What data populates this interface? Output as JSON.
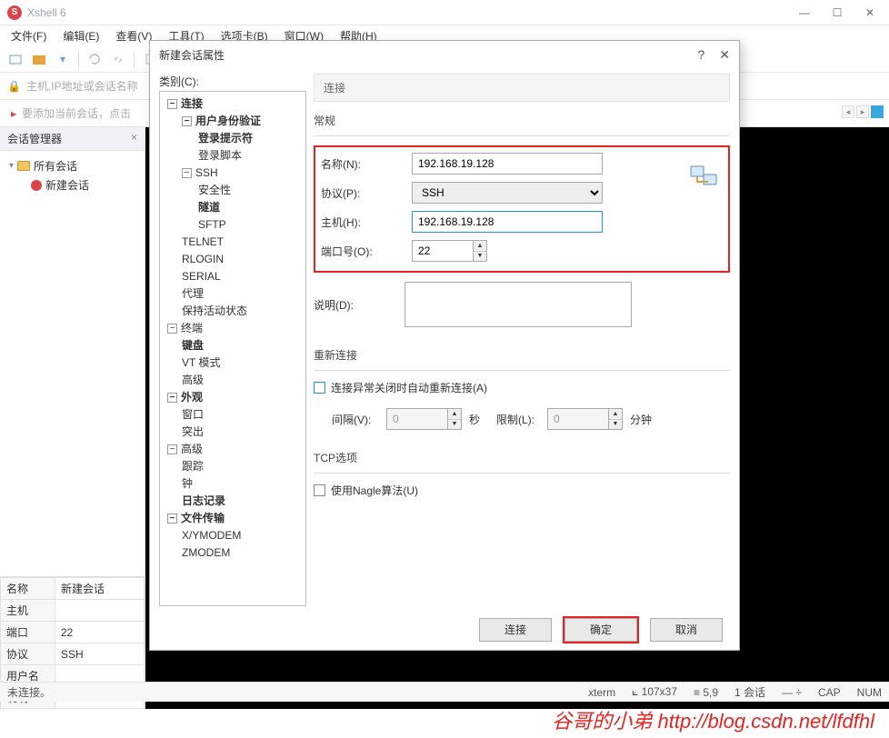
{
  "app": {
    "title": "Xshell 6"
  },
  "menu": [
    "文件(F)",
    "编辑(E)",
    "查看(V)",
    "工具(T)",
    "选项卡(B)",
    "窗口(W)",
    "帮助(H)"
  ],
  "addrbar": {
    "hint": "主机,IP地址或会话名称",
    "flag_hint": "要添加当前会话，点击"
  },
  "session_manager": {
    "title": "会话管理器",
    "root": "所有会话",
    "item": "新建会话"
  },
  "props": {
    "rows": [
      {
        "k": "名称",
        "v": "新建会话"
      },
      {
        "k": "主机",
        "v": ""
      },
      {
        "k": "端口",
        "v": "22"
      },
      {
        "k": "协议",
        "v": "SSH"
      },
      {
        "k": "用户名",
        "v": ""
      },
      {
        "k": "说明",
        "v": ""
      }
    ]
  },
  "dialog": {
    "title": "新建会话属性",
    "category_label": "类别(C):",
    "tree": [
      {
        "l": 0,
        "t": "连接",
        "b": true,
        "e": "−"
      },
      {
        "l": 1,
        "t": "用户身份验证",
        "b": true,
        "e": "−"
      },
      {
        "l": 2,
        "t": "登录提示符",
        "b": true
      },
      {
        "l": 2,
        "t": "登录脚本"
      },
      {
        "l": 1,
        "t": "SSH",
        "e": "−"
      },
      {
        "l": 2,
        "t": "安全性"
      },
      {
        "l": 2,
        "t": "隧道",
        "b": true
      },
      {
        "l": 2,
        "t": "SFTP"
      },
      {
        "l": 1,
        "t": "TELNET"
      },
      {
        "l": 1,
        "t": "RLOGIN"
      },
      {
        "l": 1,
        "t": "SERIAL"
      },
      {
        "l": 1,
        "t": "代理"
      },
      {
        "l": 1,
        "t": "保持活动状态"
      },
      {
        "l": 0,
        "t": "终端",
        "e": "−"
      },
      {
        "l": 1,
        "t": "键盘",
        "b": true
      },
      {
        "l": 1,
        "t": "VT 模式"
      },
      {
        "l": 1,
        "t": "高级"
      },
      {
        "l": 0,
        "t": "外观",
        "b": true,
        "e": "−"
      },
      {
        "l": 1,
        "t": "窗口"
      },
      {
        "l": 1,
        "t": "突出"
      },
      {
        "l": 0,
        "t": "高级",
        "e": "−"
      },
      {
        "l": 1,
        "t": "跟踪"
      },
      {
        "l": 1,
        "t": "钟"
      },
      {
        "l": 1,
        "t": "日志记录",
        "b": true
      },
      {
        "l": 0,
        "t": "文件传输",
        "b": true,
        "e": "−"
      },
      {
        "l": 1,
        "t": "X/YMODEM"
      },
      {
        "l": 1,
        "t": "ZMODEM"
      }
    ],
    "head": "连接",
    "general": {
      "title": "常规",
      "name_l": "名称(N):",
      "name_v": "192.168.19.128",
      "proto_l": "协议(P):",
      "proto_v": "SSH",
      "host_l": "主机(H):",
      "host_v": "192.168.19.128",
      "port_l": "端口号(O):",
      "port_v": "22",
      "desc_l": "说明(D):"
    },
    "reconnect": {
      "title": "重新连接",
      "chk": "连接异常关闭时自动重新连接(A)",
      "interval_l": "间隔(V):",
      "interval_v": "0",
      "interval_u": "秒",
      "limit_l": "限制(L):",
      "limit_v": "0",
      "limit_u": "分钟"
    },
    "tcp": {
      "title": "TCP选项",
      "chk": "使用Nagle算法(U)"
    },
    "buttons": {
      "connect": "连接",
      "ok": "确定",
      "cancel": "取消"
    }
  },
  "status": {
    "left": "未连接。",
    "term": "xterm",
    "size": "107x37",
    "pos": "5,9",
    "sessions_l": "1 会话",
    "cap": "CAP",
    "num": "NUM"
  },
  "watermark": "谷哥的小弟 http://blog.csdn.net/lfdfhl"
}
